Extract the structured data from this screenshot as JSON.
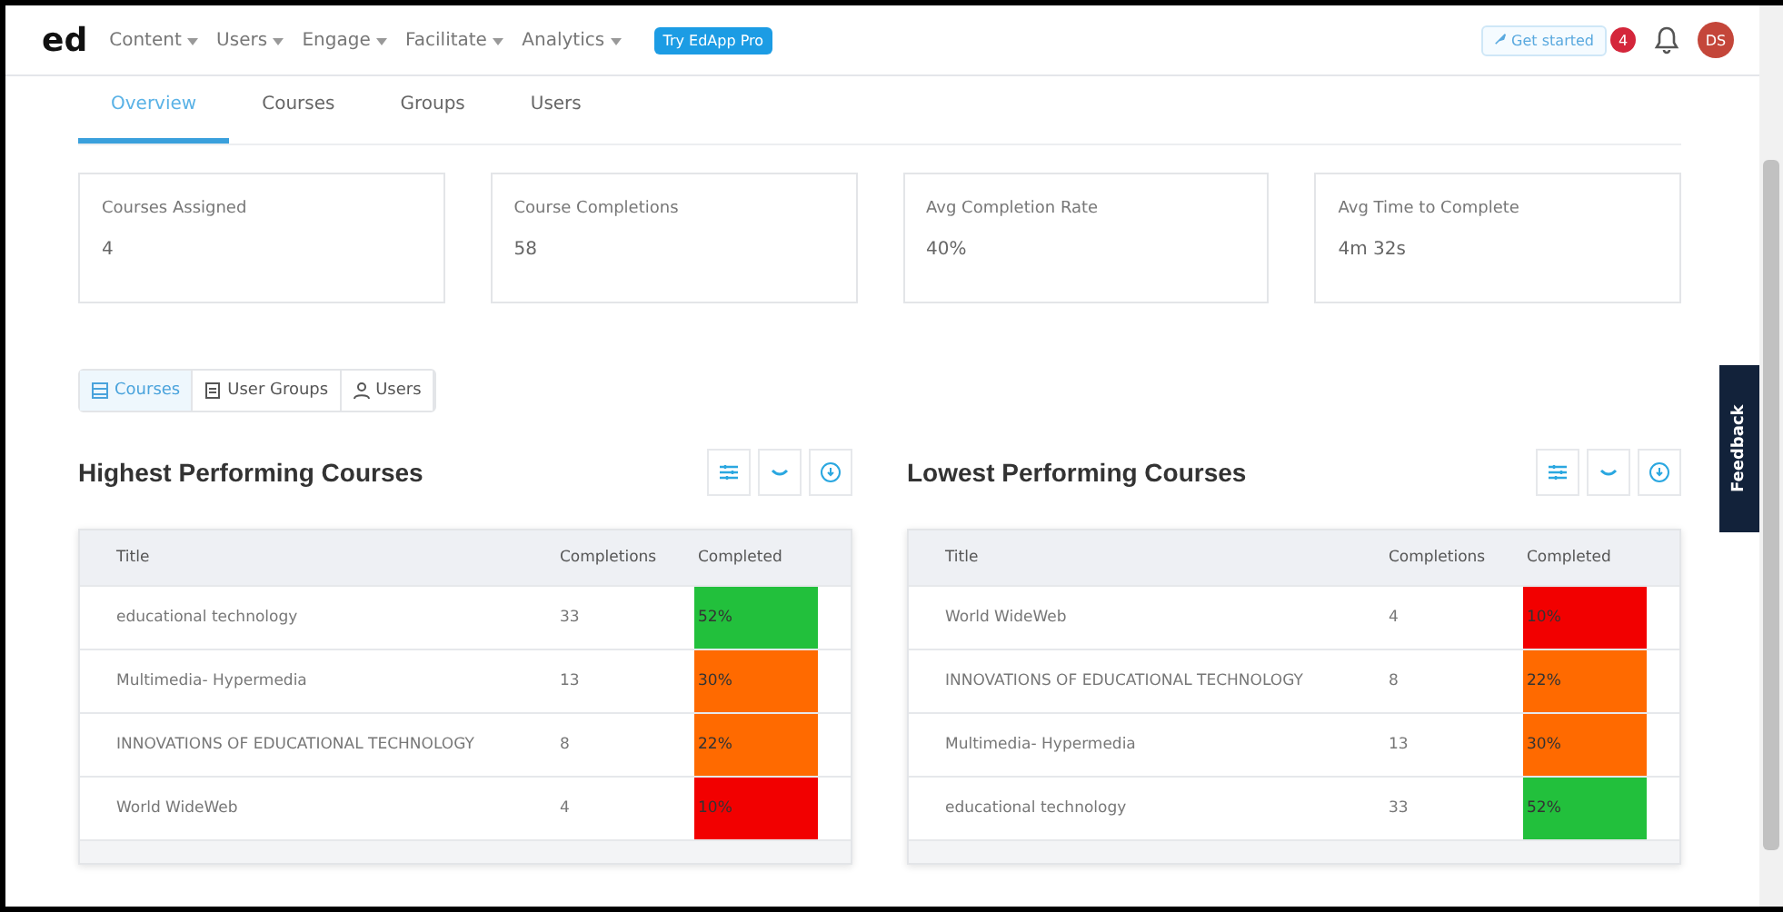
{
  "nav": {
    "logo": "ed",
    "menus": [
      "Content",
      "Users",
      "Engage",
      "Facilitate",
      "Analytics"
    ],
    "pro_button": "Try EdApp Pro",
    "get_started": "Get started",
    "badge": "4",
    "avatar": "DS"
  },
  "tabs": [
    {
      "label": "Overview",
      "selected": true
    },
    {
      "label": "Courses",
      "selected": false
    },
    {
      "label": "Groups",
      "selected": false
    },
    {
      "label": "Users",
      "selected": false
    }
  ],
  "stats": [
    {
      "label": "Courses Assigned",
      "value": "4"
    },
    {
      "label": "Course Completions",
      "value": "58"
    },
    {
      "label": "Avg Completion Rate",
      "value": "40%"
    },
    {
      "label": "Avg Time to Complete",
      "value": "4m 32s"
    }
  ],
  "segments": [
    {
      "label": "Courses",
      "kind": "courses",
      "selected": true
    },
    {
      "label": "User Groups",
      "kind": "groups",
      "selected": false
    },
    {
      "label": "Users",
      "kind": "users",
      "selected": false
    }
  ],
  "feedback": "Feedback",
  "panels": [
    {
      "title": "Highest Performing Courses",
      "columns": [
        "Title",
        "Completions",
        "Completed"
      ],
      "rows": [
        {
          "title": "educational technology",
          "completions": "33",
          "completed": "52%",
          "color": "#22c03c"
        },
        {
          "title": "Multimedia- Hypermedia",
          "completions": "13",
          "completed": "30%",
          "color": "#ff6a00"
        },
        {
          "title": "INNOVATIONS OF EDUCATIONAL TECHNOLOGY",
          "completions": "8",
          "completed": "22%",
          "color": "#ff6a00"
        },
        {
          "title": "World WideWeb",
          "completions": "4",
          "completed": "10%",
          "color": "#f20000"
        }
      ]
    },
    {
      "title": "Lowest Performing Courses",
      "columns": [
        "Title",
        "Completions",
        "Completed"
      ],
      "rows": [
        {
          "title": "World WideWeb",
          "completions": "4",
          "completed": "10%",
          "color": "#f20000"
        },
        {
          "title": "INNOVATIONS OF EDUCATIONAL TECHNOLOGY",
          "completions": "8",
          "completed": "22%",
          "color": "#ff6a00"
        },
        {
          "title": "Multimedia- Hypermedia",
          "completions": "13",
          "completed": "30%",
          "color": "#ff6a00"
        },
        {
          "title": "educational technology",
          "completions": "33",
          "completed": "52%",
          "color": "#22c03c"
        }
      ]
    }
  ]
}
